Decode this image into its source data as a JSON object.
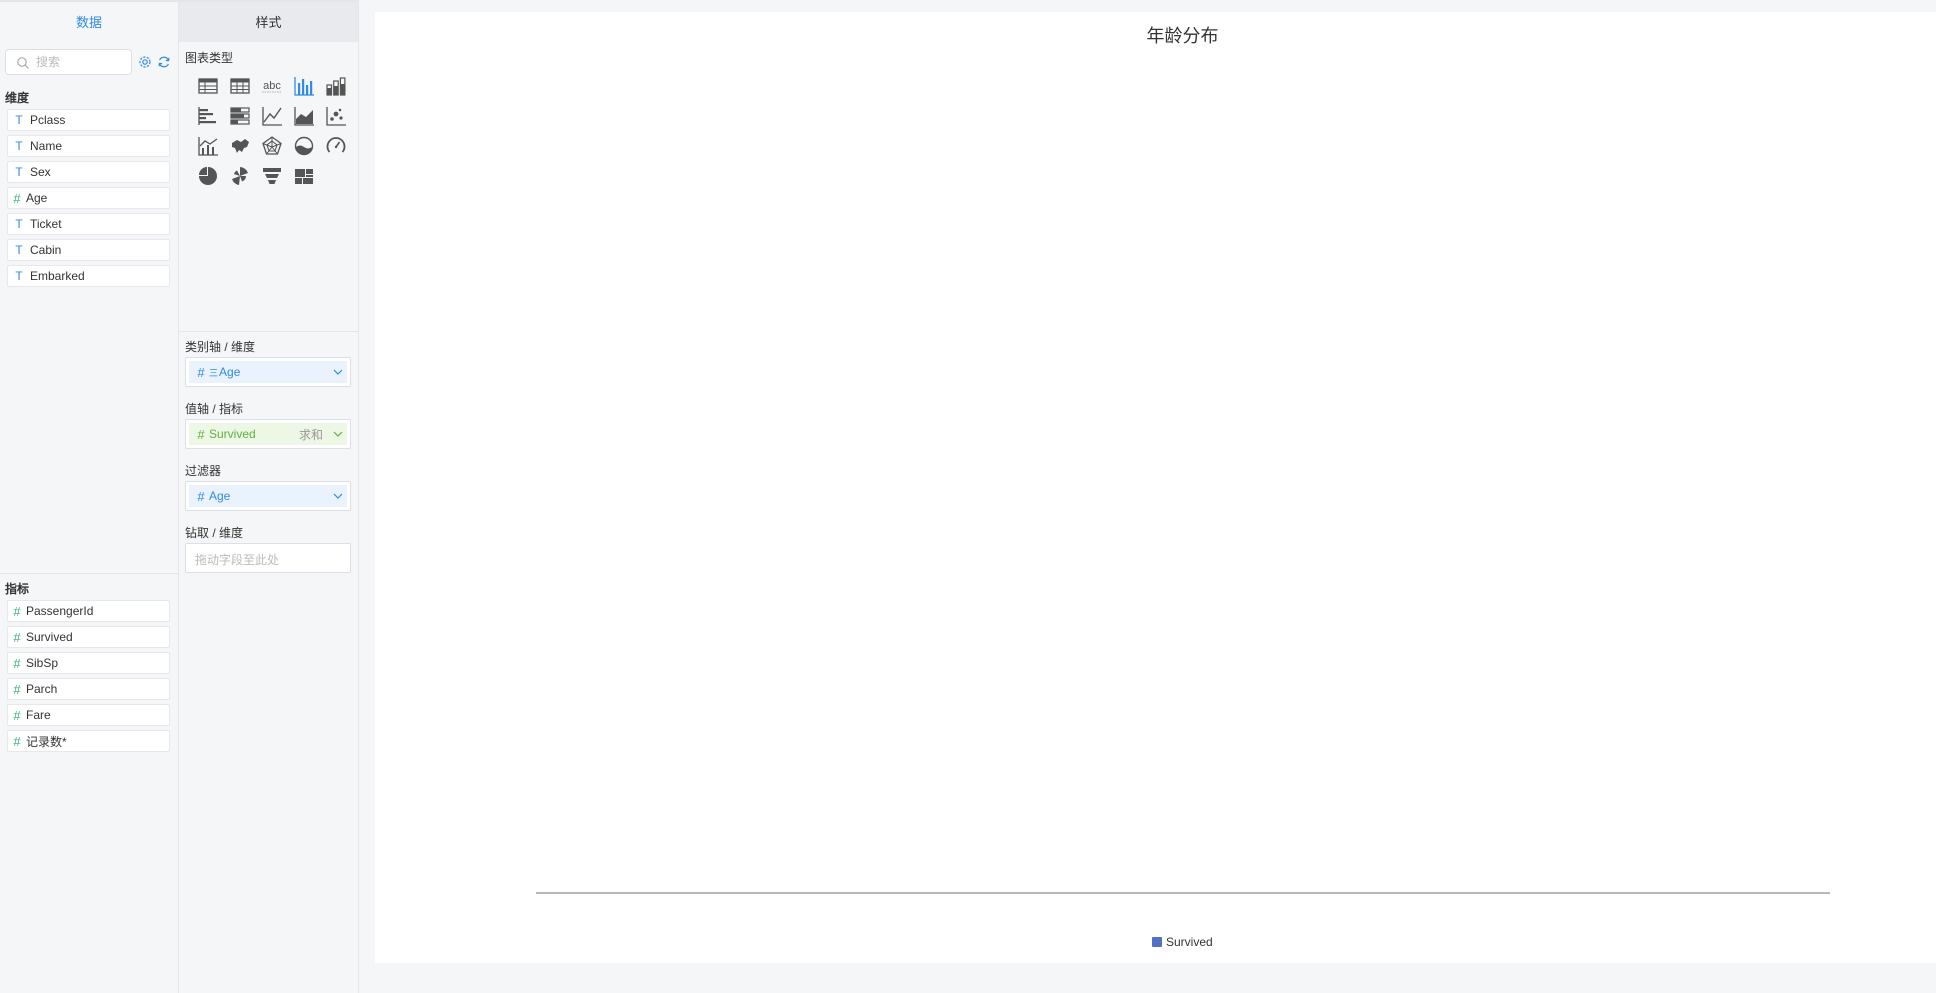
{
  "data_panel": {
    "tab_label": "数据",
    "search": {
      "placeholder": "搜索",
      "value": ""
    },
    "dimensions": {
      "title": "维度",
      "fields": [
        {
          "type": "text",
          "type_icon": "T",
          "name": "Pclass"
        },
        {
          "type": "text",
          "type_icon": "T",
          "name": "Name"
        },
        {
          "type": "text",
          "type_icon": "T",
          "name": "Sex"
        },
        {
          "type": "number",
          "type_icon": "#",
          "name": "Age"
        },
        {
          "type": "text",
          "type_icon": "T",
          "name": "Ticket"
        },
        {
          "type": "text",
          "type_icon": "T",
          "name": "Cabin"
        },
        {
          "type": "text",
          "type_icon": "T",
          "name": "Embarked"
        }
      ]
    },
    "metrics": {
      "title": "指标",
      "fields": [
        {
          "type": "number",
          "type_icon": "#",
          "name": "PassengerId"
        },
        {
          "type": "number",
          "type_icon": "#",
          "name": "Survived"
        },
        {
          "type": "number",
          "type_icon": "#",
          "name": "SibSp"
        },
        {
          "type": "number",
          "type_icon": "#",
          "name": "Parch"
        },
        {
          "type": "number",
          "type_icon": "#",
          "name": "Fare"
        },
        {
          "type": "number",
          "type_icon": "#",
          "name": "记录数*"
        }
      ]
    }
  },
  "style_panel": {
    "tab_label": "样式",
    "chart_types_title": "图表类型",
    "chart_types": [
      {
        "icon": "table-icon"
      },
      {
        "icon": "detail-table-icon"
      },
      {
        "icon": "text-card-icon",
        "text": "abc"
      },
      {
        "icon": "bar-chart-icon",
        "selected": true
      },
      {
        "icon": "stacked-bar-icon"
      },
      {
        "icon": "horizontal-bar-icon"
      },
      {
        "icon": "horizontal-stacked-bar-icon"
      },
      {
        "icon": "line-chart-icon"
      },
      {
        "icon": "area-chart-icon"
      },
      {
        "icon": "scatter-chart-icon"
      },
      {
        "icon": "mixed-chart-icon"
      },
      {
        "icon": "map-icon"
      },
      {
        "icon": "radar-chart-icon"
      },
      {
        "icon": "liquid-chart-icon"
      },
      {
        "icon": "gauge-icon"
      },
      {
        "icon": "pie-chart-icon"
      },
      {
        "icon": "rose-chart-icon"
      },
      {
        "icon": "funnel-chart-icon"
      },
      {
        "icon": "treemap-icon"
      }
    ],
    "shelves": {
      "category_axis": {
        "label": "类别轴 / 维度",
        "pill": "Age",
        "pill_prefix": "#",
        "pill_marker": "三"
      },
      "value_axis": {
        "label": "值轴 / 指标",
        "pill": "Survived",
        "pill_prefix": "#",
        "aggregation": "求和"
      },
      "filter": {
        "label": "过滤器",
        "pill": "Age",
        "pill_prefix": "#"
      },
      "drill": {
        "label": "钻取 / 维度",
        "placeholder": "拖动字段至此处"
      }
    }
  },
  "colors": {
    "accent": "#2f8be6",
    "series": "#5470c6",
    "number_field": "#3ab07a",
    "metric_pill": "#5fb13f"
  },
  "chart_data": {
    "type": "bar",
    "title": "年龄分布",
    "categories": [],
    "series": [
      {
        "name": "Survived",
        "values": []
      }
    ],
    "legend": "bottom-center",
    "grid": false
  }
}
